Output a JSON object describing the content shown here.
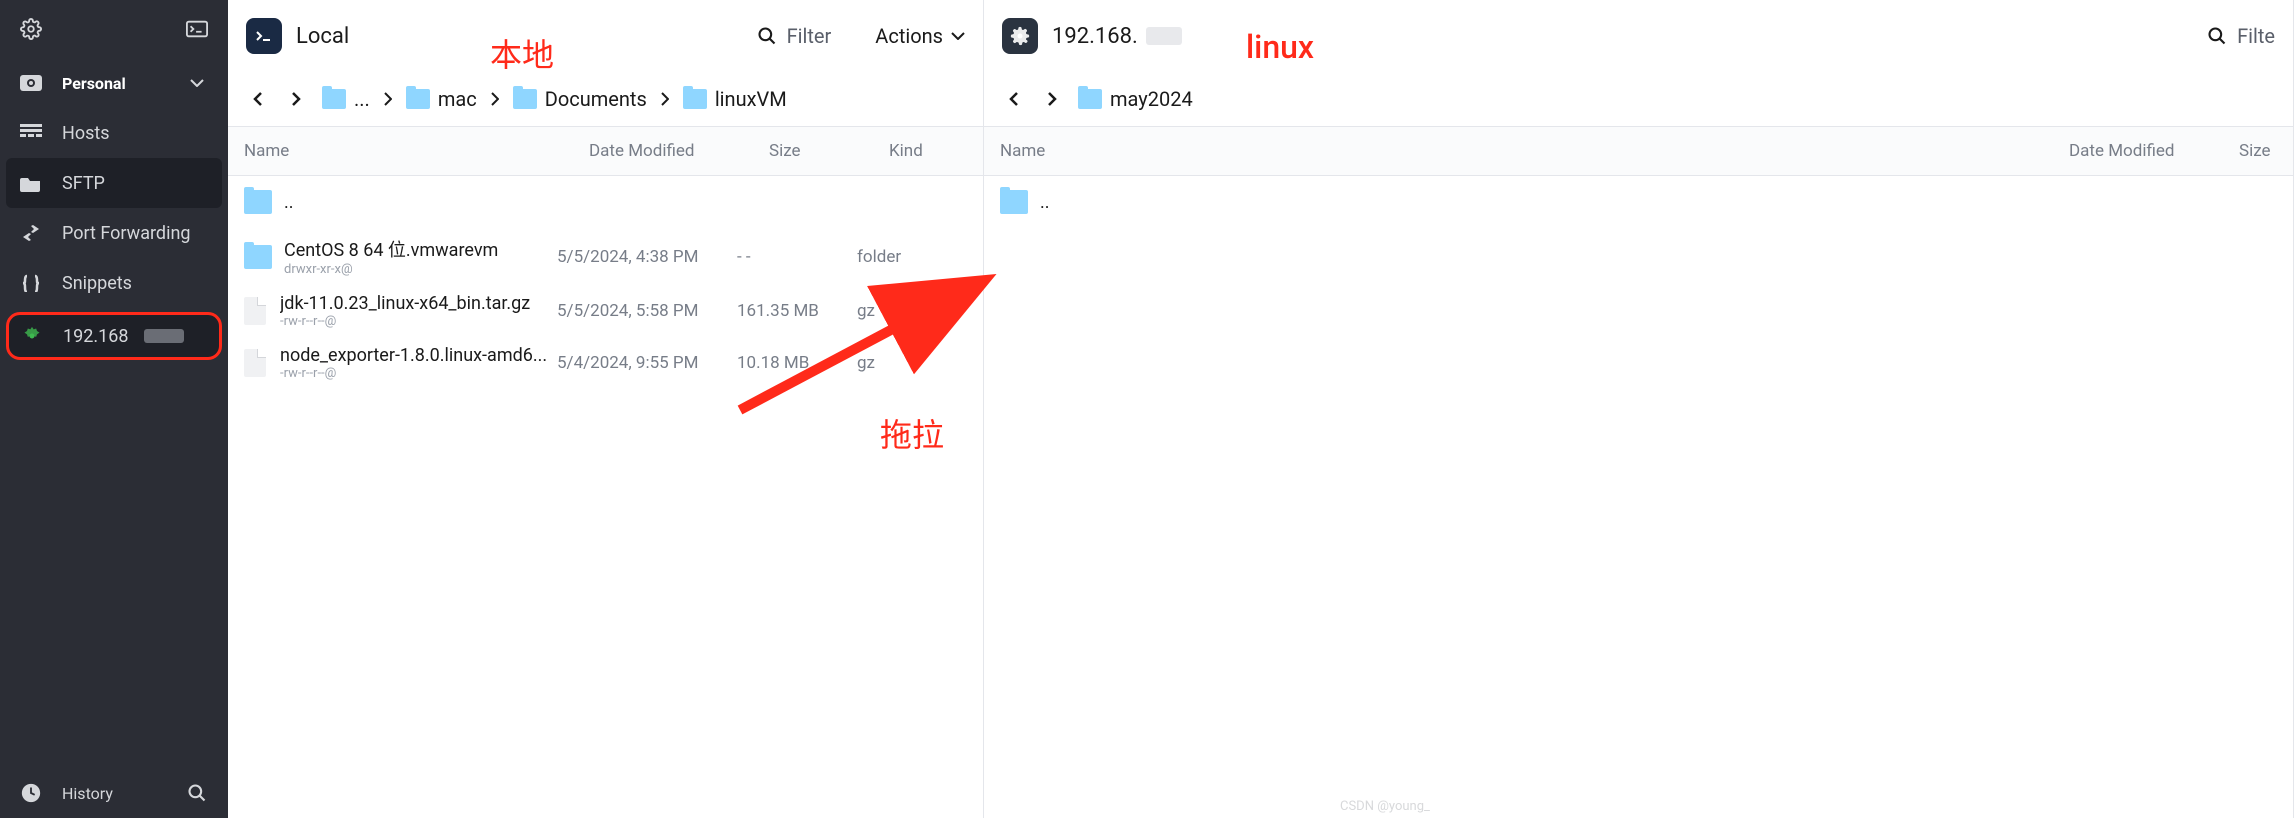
{
  "sidebar": {
    "section_label": "Personal",
    "items": [
      {
        "icon": "hosts",
        "label": "Hosts"
      },
      {
        "icon": "sftp",
        "label": "SFTP"
      },
      {
        "icon": "portfwd",
        "label": "Port Forwarding"
      },
      {
        "icon": "snippets",
        "label": "Snippets"
      }
    ],
    "host_label": "192.168",
    "history_label": "History"
  },
  "left_panel": {
    "title": "Local",
    "filter_label": "Filter",
    "actions_label": "Actions",
    "breadcrumb": [
      "...",
      "mac",
      "Documents",
      "linuxVM"
    ],
    "columns": {
      "name": "Name",
      "date": "Date Modified",
      "size": "Size",
      "kind": "Kind"
    },
    "rows": [
      {
        "type": "up",
        "name": ".."
      },
      {
        "type": "folder",
        "name": "CentOS 8 64 位.vmwarevm",
        "perm": "drwxr-xr-x@",
        "date": "5/5/2024, 4:38 PM",
        "size": "- -",
        "kind": "folder"
      },
      {
        "type": "file",
        "name": "jdk-11.0.23_linux-x64_bin.tar.gz",
        "perm": "-rw-r--r--@",
        "date": "5/5/2024, 5:58 PM",
        "size": "161.35 MB",
        "kind": "gz"
      },
      {
        "type": "file",
        "name": "node_exporter-1.8.0.linux-amd6...",
        "perm": "-rw-r--r--@",
        "date": "5/4/2024, 9:55 PM",
        "size": "10.18 MB",
        "kind": "gz"
      }
    ]
  },
  "right_panel": {
    "title": "192.168.",
    "filter_label": "Filte",
    "breadcrumb": [
      "may2024"
    ],
    "columns": {
      "name": "Name",
      "date": "Date Modified",
      "size": "Size"
    },
    "rows": [
      {
        "type": "up",
        "name": ".."
      }
    ]
  },
  "annotations": {
    "local_label": "本地",
    "linux_label": "linux",
    "drag_label": "拖拉",
    "watermark": "CSDN @young_"
  }
}
